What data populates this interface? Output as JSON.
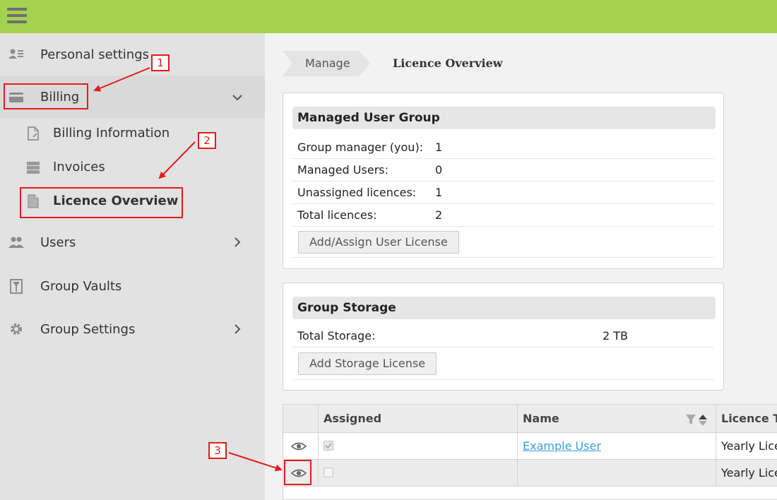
{
  "sidebar": {
    "personal_settings": "Personal settings",
    "billing": "Billing",
    "billing_information": "Billing Information",
    "invoices": "Invoices",
    "licence_overview": "Licence Overview",
    "users": "Users",
    "group_vaults": "Group Vaults",
    "group_settings": "Group Settings"
  },
  "breadcrumb": {
    "parent": "Manage",
    "current": "Licence Overview"
  },
  "managed_group": {
    "title": "Managed User Group",
    "rows": [
      {
        "label": "Group manager (you):",
        "value": "1"
      },
      {
        "label": "Managed Users:",
        "value": "0"
      },
      {
        "label": "Unassigned licences:",
        "value": "1"
      },
      {
        "label": "Total licences:",
        "value": "2"
      }
    ],
    "button": "Add/Assign User License"
  },
  "storage": {
    "title": "Group Storage",
    "rows": [
      {
        "label": "Total Storage:",
        "value": "2 TB"
      }
    ],
    "button": "Add Storage License"
  },
  "grid": {
    "columns": [
      "",
      "Assigned",
      "Name",
      "Licence Type"
    ],
    "rows": [
      {
        "assigned": true,
        "name": "Example User",
        "type": "Yearly Licence"
      },
      {
        "assigned": false,
        "name": "",
        "type": "Yearly Licence"
      }
    ]
  },
  "annotations": [
    "1",
    "2",
    "3"
  ],
  "colors": {
    "topbar": "#a3d150",
    "annotation": "#e31c1c",
    "link": "#3d9bd6"
  }
}
